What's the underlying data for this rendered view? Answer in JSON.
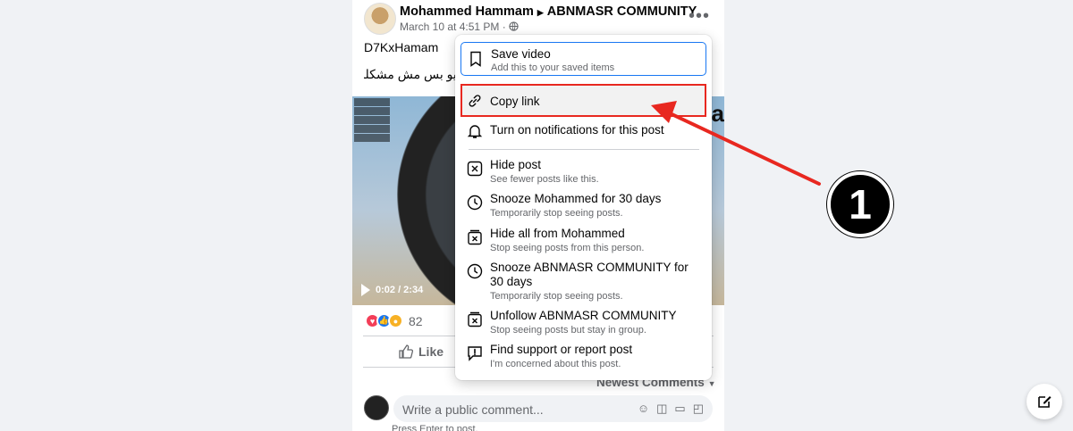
{
  "post": {
    "author": "Mohammed Hammam",
    "group": "ABNMASR COMMUNITY",
    "date": "March 10 at 4:51 PM",
    "privacy_icon": "globe-icon",
    "text_line1": "D7KxHamam",
    "text_line2": "ديو بس مش مشكله",
    "video": {
      "time": "0:02 / 2:34",
      "overlay_text": "ca"
    },
    "reaction_count": "82",
    "like_label": "Like",
    "sort_label": "Newest Comments",
    "comment_placeholder": "Write a public comment...",
    "press_enter": "Press Enter to post."
  },
  "menu": {
    "items": [
      {
        "title": "Save video",
        "sub": "Add this to your saved items",
        "icon": "bookmark-icon"
      },
      {
        "title": "Copy link",
        "sub": "",
        "icon": "link-icon"
      },
      {
        "title": "Turn on notifications for this post",
        "sub": "",
        "icon": "bell-icon"
      },
      {
        "title": "Hide post",
        "sub": "See fewer posts like this.",
        "icon": "hide-box-icon"
      },
      {
        "title": "Snooze Mohammed for 30 days",
        "sub": "Temporarily stop seeing posts.",
        "icon": "clock-icon"
      },
      {
        "title": "Hide all from Mohammed",
        "sub": "Stop seeing posts from this person.",
        "icon": "hide-all-icon"
      },
      {
        "title": "Snooze ABNMASR COMMUNITY for 30 days",
        "sub": "Temporarily stop seeing posts.",
        "icon": "clock-icon"
      },
      {
        "title": "Unfollow ABNMASR COMMUNITY",
        "sub": "Stop seeing posts but stay in group.",
        "icon": "unfollow-icon"
      },
      {
        "title": "Find support or report post",
        "sub": "I'm concerned about this post.",
        "icon": "report-icon"
      }
    ]
  },
  "annotation": {
    "step_number": "1",
    "color": "#e82820"
  },
  "colors": {
    "accent": "#1877f2",
    "highlight": "#e82820",
    "background": "#f0f2f5"
  }
}
